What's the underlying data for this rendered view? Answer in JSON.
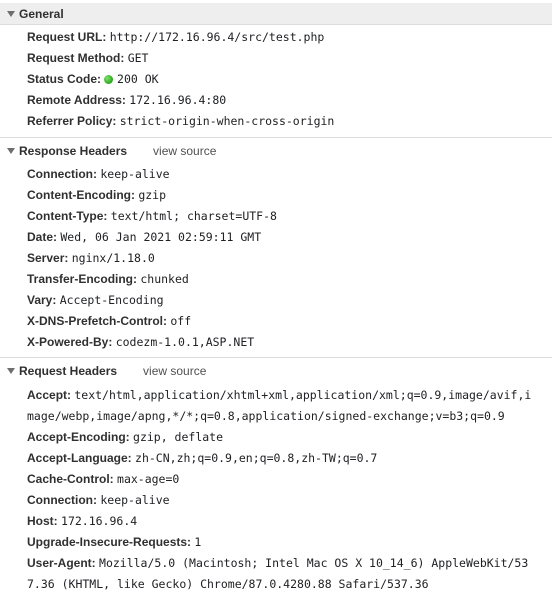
{
  "general": {
    "title": "General",
    "rows": [
      {
        "name": "Request URL:",
        "value": "http://172.16.96.4/src/test.php"
      },
      {
        "name": "Request Method:",
        "value": "GET"
      },
      {
        "name": "Status Code:",
        "value": "200 OK"
      },
      {
        "name": "Remote Address:",
        "value": "172.16.96.4:80"
      },
      {
        "name": "Referrer Policy:",
        "value": "strict-origin-when-cross-origin"
      }
    ]
  },
  "response_headers": {
    "title": "Response Headers",
    "view_source": "view source",
    "rows": [
      {
        "name": "Connection:",
        "value": "keep-alive"
      },
      {
        "name": "Content-Encoding:",
        "value": "gzip"
      },
      {
        "name": "Content-Type:",
        "value": "text/html; charset=UTF-8"
      },
      {
        "name": "Date:",
        "value": "Wed, 06 Jan 2021 02:59:11 GMT"
      },
      {
        "name": "Server:",
        "value": "nginx/1.18.0"
      },
      {
        "name": "Transfer-Encoding:",
        "value": "chunked"
      },
      {
        "name": "Vary:",
        "value": "Accept-Encoding"
      },
      {
        "name": "X-DNS-Prefetch-Control:",
        "value": "off"
      },
      {
        "name": "X-Powered-By:",
        "value": "codezm-1.0.1,ASP.NET"
      }
    ]
  },
  "request_headers": {
    "title": "Request Headers",
    "view_source": "view source",
    "accept_name": "Accept:",
    "accept_value_line1": "text/html,application/xhtml+xml,application/xml;q=0.9,image/avif,i",
    "accept_value_line2": "mage/webp,image/apng,*/*;q=0.8,application/signed-exchange;v=b3;q=0.9",
    "rows": [
      {
        "name": "Accept-Encoding:",
        "value": "gzip, deflate"
      },
      {
        "name": "Accept-Language:",
        "value": "zh-CN,zh;q=0.9,en;q=0.8,zh-TW;q=0.7"
      },
      {
        "name": "Cache-Control:",
        "value": "max-age=0"
      },
      {
        "name": "Connection:",
        "value": "keep-alive"
      },
      {
        "name": "Host:",
        "value": "172.16.96.4"
      },
      {
        "name": "Upgrade-Insecure-Requests:",
        "value": "1"
      }
    ],
    "ua_name": "User-Agent:",
    "ua_value_line1": "Mozilla/5.0 (Macintosh; Intel Mac OS X 10_14_6) AppleWebKit/53",
    "ua_value_line2": "7.36 (KHTML, like Gecko) Chrome/87.0.4280.88 Safari/537.36"
  },
  "colors": {
    "status_ok": "#2aa61c",
    "header_bg": "#eeeeee"
  }
}
